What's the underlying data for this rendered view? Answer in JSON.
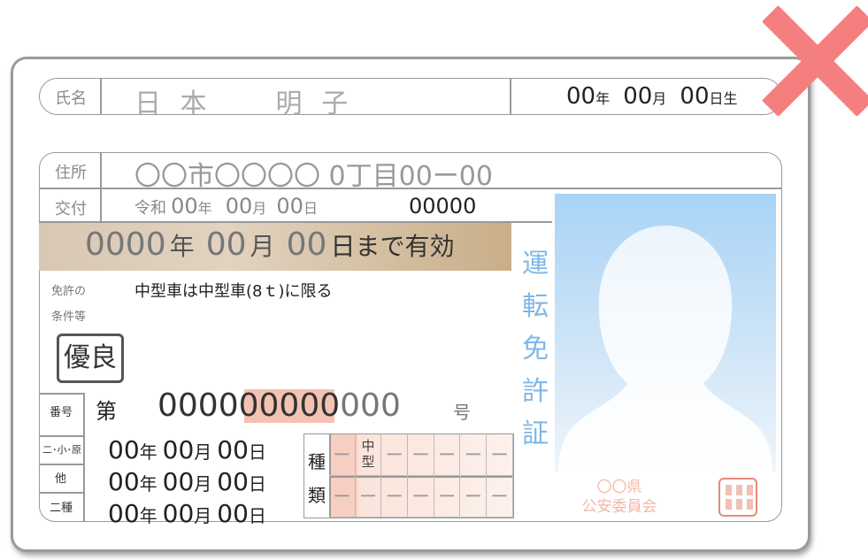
{
  "name_row": {
    "label": "氏名",
    "name": "日 本　　明 子",
    "birth_year_num": "00",
    "birth_year_unit": "年",
    "birth_month_num": "00",
    "birth_month_unit": "月",
    "birth_day_num": "00",
    "birth_day_unit": "日生"
  },
  "address_row": {
    "label": "住所",
    "value": "〇〇市〇〇〇〇 0丁目00ー00"
  },
  "issue_row": {
    "label": "交付",
    "era": "令和",
    "year_num": "00",
    "year_unit": "年",
    "month_num": "00",
    "month_unit": "月",
    "day_num": "00",
    "day_unit": "日",
    "serial": "00000"
  },
  "valid_until": {
    "year_num": "0000",
    "year_unit": "年",
    "month_num": "00",
    "month_unit": "月",
    "day_num": "00",
    "suffix": "日まで有効"
  },
  "conditions": {
    "label_line1": "免許の",
    "label_line2": "条件等",
    "value": "中型車は中型車(8ｔ)に限る"
  },
  "badge": "優良",
  "license_number": {
    "label": "番号",
    "prefix": "第",
    "number_a": "0000",
    "number_b": "00000",
    "number_c": "000",
    "suffix": "号"
  },
  "date_rows": [
    {
      "label": "二･小･原",
      "year": "00",
      "year_unit": "年",
      "month": "00",
      "month_unit": "月",
      "day": "00",
      "day_unit": "日"
    },
    {
      "label": "他",
      "year": "00",
      "year_unit": "年",
      "month": "00",
      "month_unit": "月",
      "day": "00",
      "day_unit": "日"
    },
    {
      "label": "二種",
      "year": "00",
      "year_unit": "年",
      "month": "00",
      "month_unit": "月",
      "day": "00",
      "day_unit": "日"
    }
  ],
  "types": {
    "label_top": "種",
    "label_bottom": "類",
    "top_row": [
      "ー",
      "中\n型",
      "ー",
      "ー",
      "ー",
      "ー",
      "ー"
    ],
    "bottom_row": [
      "ー",
      "ー",
      "ー",
      "ー",
      "ー",
      "ー",
      "ー"
    ]
  },
  "vertical_title": [
    "運",
    "転",
    "免",
    "許",
    "証"
  ],
  "issuer": {
    "line1": "〇〇県",
    "line2": "公安委員会"
  },
  "colors": {
    "cross": "#f57f7f",
    "vertical_title": "#7fb7e6",
    "issuer": "#f2b8a8"
  }
}
